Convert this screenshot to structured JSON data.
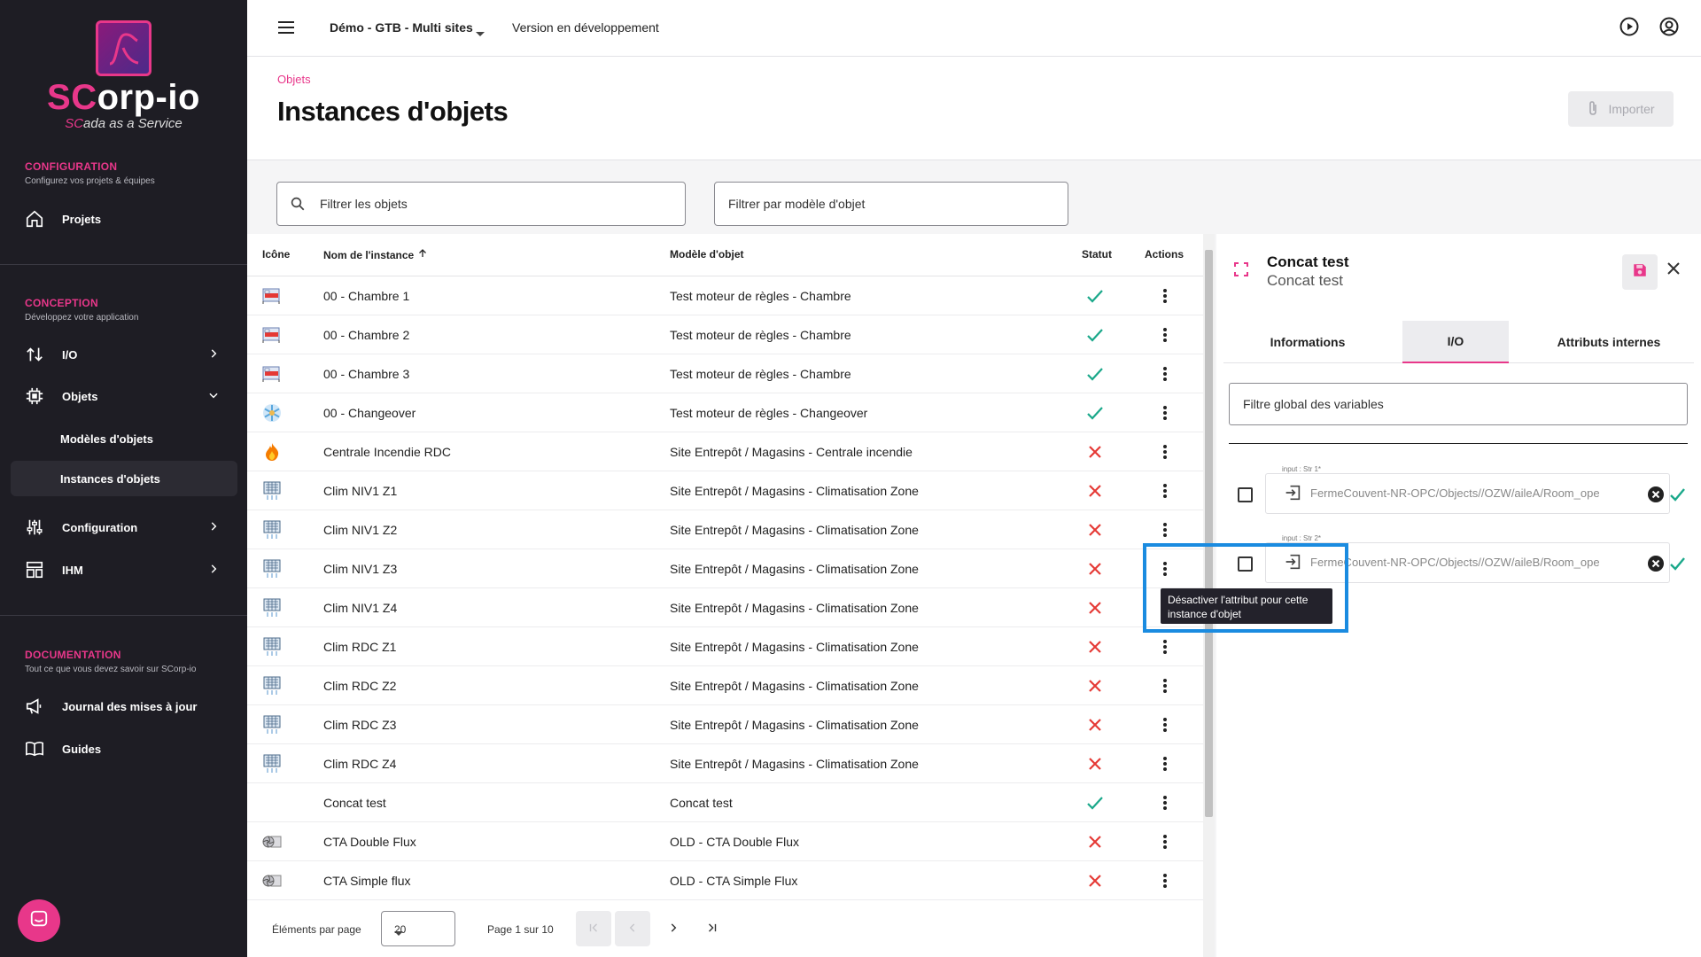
{
  "sidebar": {
    "logo_text_a": "SC",
    "logo_text_b": "orp-io",
    "tagline_a": "SC",
    "tagline_b": "ada as a Service",
    "sections": [
      {
        "title": "CONFIGURATION",
        "subtitle": "Configurez vos projets & équipes"
      },
      {
        "title": "CONCEPTION",
        "subtitle": "Développez votre application"
      },
      {
        "title": "DOCUMENTATION",
        "subtitle": "Tout ce que vous devez savoir sur SCorp-io"
      }
    ],
    "items": {
      "projets": "Projets",
      "io": "I/O",
      "objets": "Objets",
      "modeles": "Modèles d'objets",
      "instances": "Instances d'objets",
      "configuration": "Configuration",
      "ihm": "IHM",
      "journal": "Journal des mises à jour",
      "guides": "Guides"
    }
  },
  "topbar": {
    "site": "Démo - GTB - Multi sites",
    "version": "Version en développement"
  },
  "header": {
    "breadcrumb": "Objets",
    "title": "Instances d'objets",
    "import_label": "Importer"
  },
  "filters": {
    "objects_placeholder": "Filtrer les objets",
    "model_placeholder": "Filtrer par modèle d'objet"
  },
  "table": {
    "columns": {
      "icon": "Icône",
      "name": "Nom de l'instance",
      "model": "Modèle d'objet",
      "status": "Statut",
      "actions": "Actions"
    },
    "rows": [
      {
        "name": "00 - Chambre 1",
        "model": "Test moteur de règles - Chambre",
        "status": "ok",
        "icon": "bed-icon"
      },
      {
        "name": "00 - Chambre 2",
        "model": "Test moteur de règles - Chambre",
        "status": "ok",
        "icon": "bed-icon"
      },
      {
        "name": "00 - Chambre 3",
        "model": "Test moteur de règles - Chambre",
        "status": "ok",
        "icon": "bed-icon"
      },
      {
        "name": "00 - Changeover",
        "model": "Test moteur de règles - Changeover",
        "status": "ok",
        "icon": "snowflake-icon"
      },
      {
        "name": "Centrale Incendie RDC",
        "model": "Site Entrepôt / Magasins - Centrale incendie",
        "status": "error",
        "icon": "fire-icon"
      },
      {
        "name": "Clim NIV1 Z1",
        "model": "Site Entrepôt / Magasins - Climatisation Zone",
        "status": "error",
        "icon": "ac-unit-icon"
      },
      {
        "name": "Clim NIV1 Z2",
        "model": "Site Entrepôt / Magasins - Climatisation Zone",
        "status": "error",
        "icon": "ac-unit-icon"
      },
      {
        "name": "Clim NIV1 Z3",
        "model": "Site Entrepôt / Magasins - Climatisation Zone",
        "status": "error",
        "icon": "ac-unit-icon"
      },
      {
        "name": "Clim NIV1 Z4",
        "model": "Site Entrepôt / Magasins - Climatisation Zone",
        "status": "error",
        "icon": "ac-unit-icon"
      },
      {
        "name": "Clim RDC Z1",
        "model": "Site Entrepôt / Magasins - Climatisation Zone",
        "status": "error",
        "icon": "ac-unit-icon"
      },
      {
        "name": "Clim RDC Z2",
        "model": "Site Entrepôt / Magasins - Climatisation Zone",
        "status": "error",
        "icon": "ac-unit-icon"
      },
      {
        "name": "Clim RDC Z3",
        "model": "Site Entrepôt / Magasins - Climatisation Zone",
        "status": "error",
        "icon": "ac-unit-icon"
      },
      {
        "name": "Clim RDC Z4",
        "model": "Site Entrepôt / Magasins - Climatisation Zone",
        "status": "error",
        "icon": "ac-unit-icon"
      },
      {
        "name": "Concat test",
        "model": "Concat test",
        "status": "ok",
        "icon": ""
      },
      {
        "name": "CTA Double Flux",
        "model": "OLD - CTA Double Flux",
        "status": "error",
        "icon": "fan-unit-icon"
      },
      {
        "name": "CTA Simple flux",
        "model": "OLD - CTA Simple Flux",
        "status": "error",
        "icon": "fan-unit-icon"
      }
    ]
  },
  "pager": {
    "per_page_label": "Éléments par page",
    "per_page_value": "20",
    "page_label": "Page 1 sur 10"
  },
  "panel": {
    "title": "Concat test",
    "subtitle": "Concat test",
    "tabs": [
      "Informations",
      "I/O",
      "Attributs internes"
    ],
    "active_tab": 1,
    "filter_placeholder": "Filtre global des variables",
    "io": [
      {
        "label": "input : Str 1*",
        "value": "FermeCouvent-NR-OPC/Objects//OZW/aileA/Room_ope"
      },
      {
        "label": "input : Str 2*",
        "value": "FermeCouvent-NR-OPC/Objects//OZW/aileB/Room_ope"
      }
    ],
    "tooltip": "Désactiver l'attribut pour cette instance d'objet"
  },
  "colors": {
    "accent": "#e8378a",
    "ok": "#1aa88a",
    "error": "#e53935",
    "highlight": "#1a8be0",
    "sidebar": "#1e1d24"
  }
}
